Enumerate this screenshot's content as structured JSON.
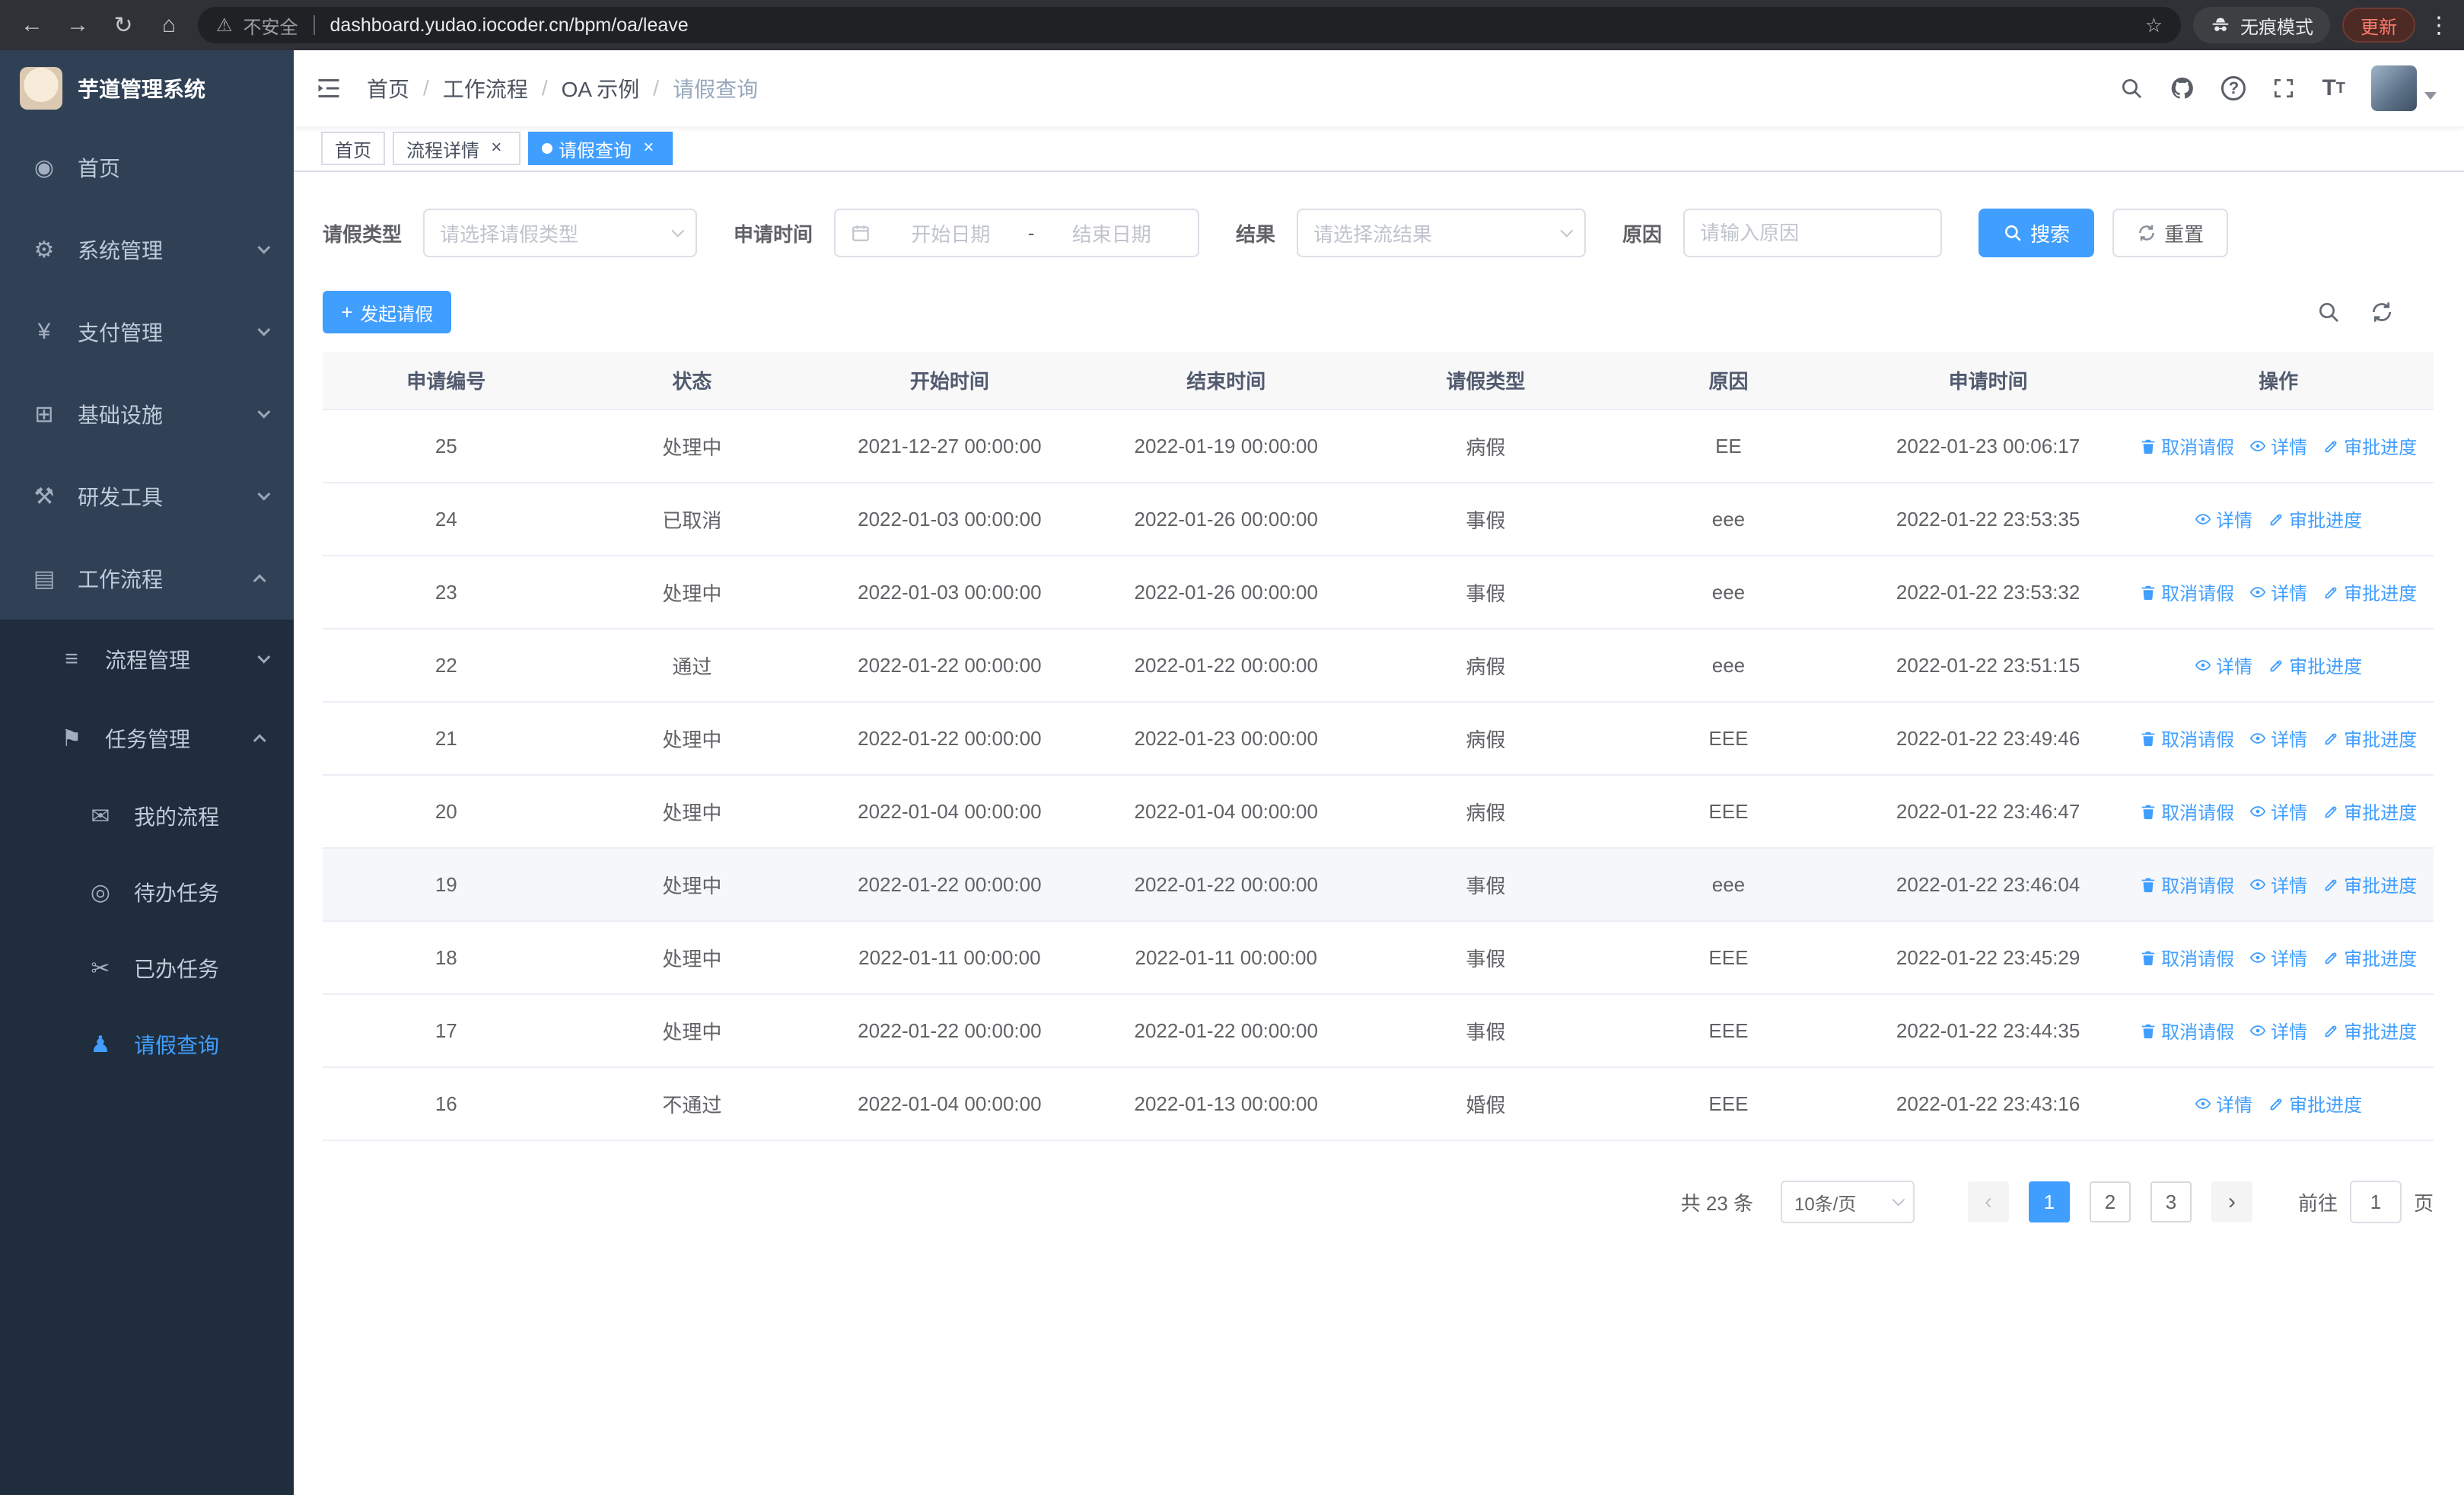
{
  "browser": {
    "security_label": "不安全",
    "url": "dashboard.yudao.iocoder.cn/bpm/oa/leave",
    "incognito_label": "无痕模式",
    "update_label": "更新"
  },
  "colors": {
    "primary": "#409eff",
    "sidebar_bg": "#304156",
    "submenu_bg": "#1f2d3d"
  },
  "icon_glyphs": {
    "home-icon": "◉",
    "system-icon": "⚙",
    "payment-icon": "¥",
    "infra-icon": "⊞",
    "devtools-icon": "⚒",
    "workflow-icon": "▤",
    "process-mgmt-icon": "≡",
    "task-mgmt-icon": "⚑",
    "my-process-icon": "✉",
    "todo-task-icon": "◎",
    "done-task-icon": "✂",
    "leave-query-icon": "♟"
  },
  "sidebar": {
    "logo_title": "芋道管理系统",
    "items": [
      {
        "name": "home",
        "label": "首页",
        "icon": "home-icon",
        "level": 1
      },
      {
        "name": "system-management",
        "label": "系统管理",
        "icon": "system-icon",
        "level": 1,
        "arrow": "down"
      },
      {
        "name": "payment-management",
        "label": "支付管理",
        "icon": "payment-icon",
        "level": 1,
        "arrow": "down"
      },
      {
        "name": "infrastructure",
        "label": "基础设施",
        "icon": "infra-icon",
        "level": 1,
        "arrow": "down"
      },
      {
        "name": "dev-tools",
        "label": "研发工具",
        "icon": "devtools-icon",
        "level": 1,
        "arrow": "down"
      },
      {
        "name": "workflow",
        "label": "工作流程",
        "icon": "workflow-icon",
        "level": 1,
        "arrow": "up"
      },
      {
        "name": "process-management",
        "label": "流程管理",
        "icon": "process-mgmt-icon",
        "level": 2,
        "arrow": "down"
      },
      {
        "name": "task-management",
        "label": "任务管理",
        "icon": "task-mgmt-icon",
        "level": 2,
        "arrow": "up"
      },
      {
        "name": "my-process",
        "label": "我的流程",
        "icon": "my-process-icon",
        "level": 3
      },
      {
        "name": "todo-tasks",
        "label": "待办任务",
        "icon": "todo-task-icon",
        "level": 3
      },
      {
        "name": "done-tasks",
        "label": "已办任务",
        "icon": "done-task-icon",
        "level": 3
      },
      {
        "name": "leave-query",
        "label": "请假查询",
        "icon": "leave-query-icon",
        "level": 3,
        "active": true
      }
    ]
  },
  "header": {
    "breadcrumb": [
      "首页",
      "工作流程",
      "OA 示例",
      "请假查询"
    ]
  },
  "tabs": [
    {
      "name": "tab-home",
      "label": "首页",
      "closable": false,
      "active": false
    },
    {
      "name": "tab-process-detail",
      "label": "流程详情",
      "closable": true,
      "active": false
    },
    {
      "name": "tab-leave-query",
      "label": "请假查询",
      "closable": true,
      "active": true
    }
  ],
  "filters": {
    "leave_type_label": "请假类型",
    "leave_type_placeholder": "请选择请假类型",
    "apply_time_label": "申请时间",
    "start_date_placeholder": "开始日期",
    "range_separator": "-",
    "end_date_placeholder": "结束日期",
    "result_label": "结果",
    "result_placeholder": "请选择流结果",
    "reason_label": "原因",
    "reason_placeholder": "请输入原因",
    "search_label": "搜索",
    "reset_label": "重置"
  },
  "toolbar": {
    "create_label": "发起请假"
  },
  "table": {
    "columns": [
      "申请编号",
      "状态",
      "开始时间",
      "结束时间",
      "请假类型",
      "原因",
      "申请时间",
      "操作"
    ],
    "op_labels": {
      "cancel": "取消请假",
      "detail": "详情",
      "progress": "审批进度"
    },
    "rows": [
      {
        "id": "25",
        "status": "处理中",
        "start": "2021-12-27 00:00:00",
        "end": "2022-01-19 00:00:00",
        "type": "病假",
        "reason": "EE",
        "applied": "2022-01-23 00:06:17",
        "ops": [
          "cancel",
          "detail",
          "progress"
        ]
      },
      {
        "id": "24",
        "status": "已取消",
        "start": "2022-01-03 00:00:00",
        "end": "2022-01-26 00:00:00",
        "type": "事假",
        "reason": "eee",
        "applied": "2022-01-22 23:53:35",
        "ops": [
          "detail",
          "progress"
        ]
      },
      {
        "id": "23",
        "status": "处理中",
        "start": "2022-01-03 00:00:00",
        "end": "2022-01-26 00:00:00",
        "type": "事假",
        "reason": "eee",
        "applied": "2022-01-22 23:53:32",
        "ops": [
          "cancel",
          "detail",
          "progress"
        ]
      },
      {
        "id": "22",
        "status": "通过",
        "start": "2022-01-22 00:00:00",
        "end": "2022-01-22 00:00:00",
        "type": "病假",
        "reason": "eee",
        "applied": "2022-01-22 23:51:15",
        "ops": [
          "detail",
          "progress"
        ]
      },
      {
        "id": "21",
        "status": "处理中",
        "start": "2022-01-22 00:00:00",
        "end": "2022-01-23 00:00:00",
        "type": "病假",
        "reason": "EEE",
        "applied": "2022-01-22 23:49:46",
        "ops": [
          "cancel",
          "detail",
          "progress"
        ]
      },
      {
        "id": "20",
        "status": "处理中",
        "start": "2022-01-04 00:00:00",
        "end": "2022-01-04 00:00:00",
        "type": "病假",
        "reason": "EEE",
        "applied": "2022-01-22 23:46:47",
        "ops": [
          "cancel",
          "detail",
          "progress"
        ]
      },
      {
        "id": "19",
        "status": "处理中",
        "start": "2022-01-22 00:00:00",
        "end": "2022-01-22 00:00:00",
        "type": "事假",
        "reason": "eee",
        "applied": "2022-01-22 23:46:04",
        "ops": [
          "cancel",
          "detail",
          "progress"
        ],
        "highlighted": true
      },
      {
        "id": "18",
        "status": "处理中",
        "start": "2022-01-11 00:00:00",
        "end": "2022-01-11 00:00:00",
        "type": "事假",
        "reason": "EEE",
        "applied": "2022-01-22 23:45:29",
        "ops": [
          "cancel",
          "detail",
          "progress"
        ]
      },
      {
        "id": "17",
        "status": "处理中",
        "start": "2022-01-22 00:00:00",
        "end": "2022-01-22 00:00:00",
        "type": "事假",
        "reason": "EEE",
        "applied": "2022-01-22 23:44:35",
        "ops": [
          "cancel",
          "detail",
          "progress"
        ]
      },
      {
        "id": "16",
        "status": "不通过",
        "start": "2022-01-04 00:00:00",
        "end": "2022-01-13 00:00:00",
        "type": "婚假",
        "reason": "EEE",
        "applied": "2022-01-22 23:43:16",
        "ops": [
          "detail",
          "progress"
        ]
      }
    ]
  },
  "pagination": {
    "total_label": "共 23 条",
    "page_size_label": "10条/页",
    "pages": [
      "1",
      "2",
      "3"
    ],
    "active_page": "1",
    "goto_label": "前往",
    "goto_value": "1",
    "page_unit_label": "页"
  }
}
